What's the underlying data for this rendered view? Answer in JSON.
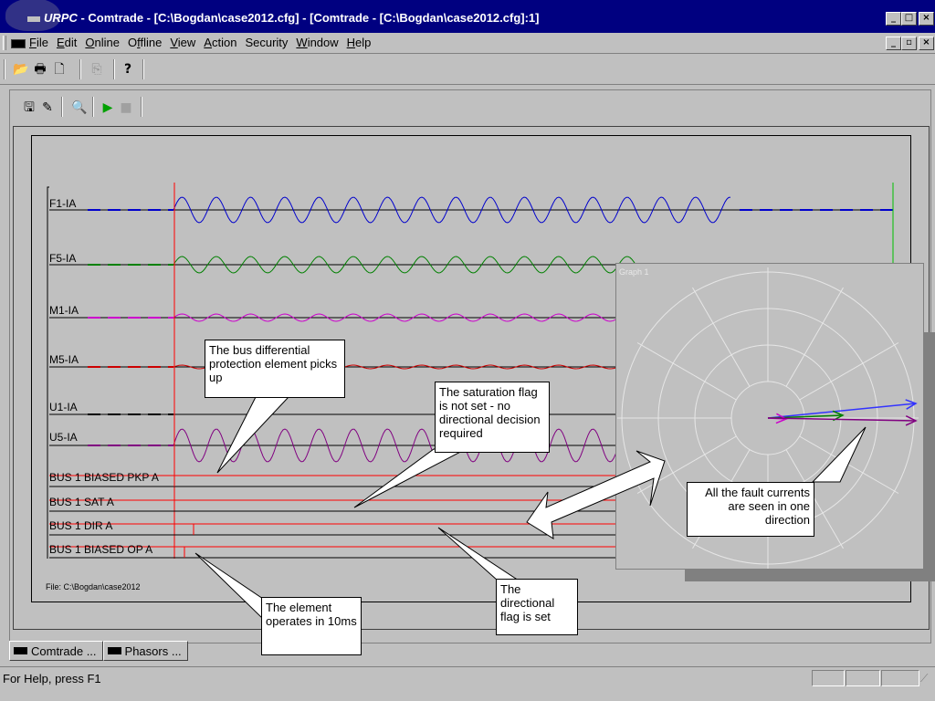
{
  "window": {
    "app": "URPC",
    "title": " - Comtrade - [C:\\Bogdan\\case2012.cfg] - [Comtrade - [C:\\Bogdan\\case2012.cfg]:1]",
    "controls": [
      "_",
      "□",
      "×"
    ],
    "child_controls": [
      "_",
      "▫",
      "×"
    ]
  },
  "menu": [
    {
      "label": "File",
      "key": "F"
    },
    {
      "label": "Edit",
      "key": "E"
    },
    {
      "label": "Online",
      "key": "O"
    },
    {
      "label": "Offline",
      "key": "f"
    },
    {
      "label": "View",
      "key": "V"
    },
    {
      "label": "Action",
      "key": "A"
    },
    {
      "label": "Security",
      "key": ""
    },
    {
      "label": "Window",
      "key": "W"
    },
    {
      "label": "Help",
      "key": "H"
    }
  ],
  "toolbar": {
    "icons": [
      "open-folder-icon",
      "print-icon",
      "print-preview-icon",
      "copy-icon",
      "help-icon"
    ]
  },
  "inner_toolbar": {
    "icons": [
      "save-icon",
      "edit-icon",
      "zoom-icon",
      "play-icon",
      "stop-icon"
    ]
  },
  "traces": [
    {
      "label": "F1-IA",
      "color": "#0000cc"
    },
    {
      "label": "F5-IA",
      "color": "#008000"
    },
    {
      "label": "M1-IA",
      "color": "#cc00cc"
    },
    {
      "label": "M5-IA",
      "color": "#cc0000"
    },
    {
      "label": "U1-IA",
      "color": "#000000"
    },
    {
      "label": "U5-IA",
      "color": "#800080"
    }
  ],
  "digital_traces": [
    {
      "label": "BUS 1 BIASED PKP A"
    },
    {
      "label": "BUS 1 SAT A"
    },
    {
      "label": "BUS 1 DIR A"
    },
    {
      "label": "BUS 1 BIASED OP A"
    }
  ],
  "file_label": "File: C:\\Bogdan\\case2012",
  "polar": {
    "title": "Graph 1",
    "phasors": [
      {
        "color": "#3333ff"
      },
      {
        "color": "#008000"
      },
      {
        "color": "#cc00cc"
      },
      {
        "color": "#800080"
      }
    ]
  },
  "callouts": {
    "pickup": "The bus differential protection element picks up",
    "saturation": "The saturation flag is not set - no directional decision required",
    "fault_direction": "All the fault currents are seen in one direction",
    "directional": "The directional flag is set",
    "operates": "The element operates in 10ms"
  },
  "tabs": [
    {
      "label": "Comtrade ..."
    },
    {
      "label": "Phasors ..."
    }
  ],
  "status": {
    "text": "For Help, press F1"
  }
}
